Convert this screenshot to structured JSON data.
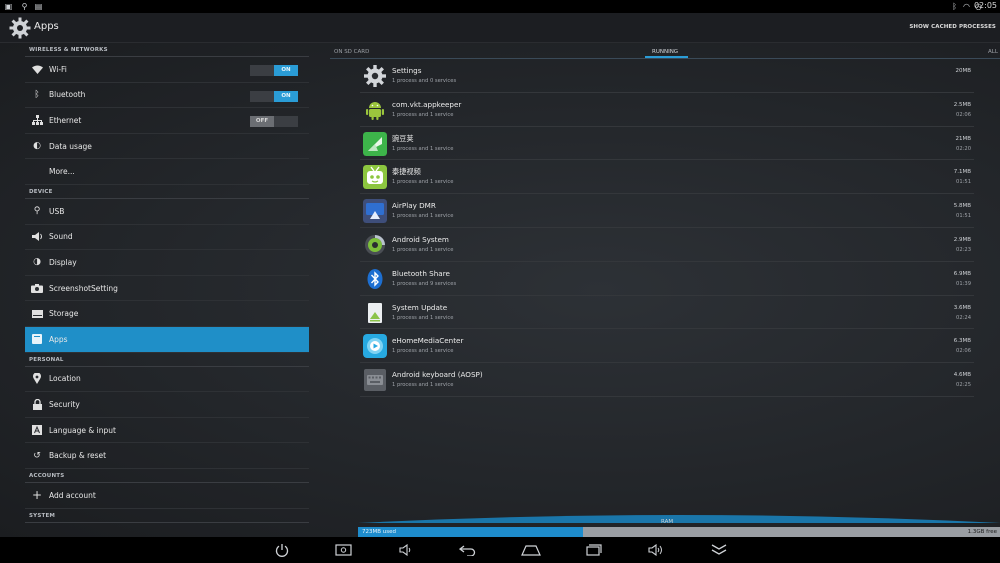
{
  "status_bar": {
    "time": "02:05",
    "left_icons": [
      "screenshot-icon",
      "usb-icon",
      "download-icon"
    ],
    "right_icons": [
      "bluetooth-icon",
      "wifi-icon",
      "clock-icon"
    ]
  },
  "action_bar": {
    "title": "Apps",
    "action": "SHOW CACHED PROCESSES"
  },
  "sidebar": {
    "sections": [
      {
        "header": "WIRELESS & NETWORKS",
        "items": [
          {
            "label": "Wi-Fi",
            "icon": "wifi-icon",
            "toggle": "ON"
          },
          {
            "label": "Bluetooth",
            "icon": "bluetooth-icon",
            "toggle": "ON"
          },
          {
            "label": "Ethernet",
            "icon": "ethernet-icon",
            "toggle": "OFF"
          },
          {
            "label": "Data usage",
            "icon": "data-usage-icon"
          },
          {
            "label": "More..."
          }
        ]
      },
      {
        "header": "DEVICE",
        "items": [
          {
            "label": "USB",
            "icon": "usb-icon"
          },
          {
            "label": "Sound",
            "icon": "sound-icon"
          },
          {
            "label": "Display",
            "icon": "display-icon"
          },
          {
            "label": "ScreenshotSetting",
            "icon": "camera-icon"
          },
          {
            "label": "Storage",
            "icon": "storage-icon"
          },
          {
            "label": "Apps",
            "icon": "apps-icon",
            "selected": true
          }
        ]
      },
      {
        "header": "PERSONAL",
        "items": [
          {
            "label": "Location",
            "icon": "location-icon"
          },
          {
            "label": "Security",
            "icon": "lock-icon"
          },
          {
            "label": "Language & input",
            "icon": "language-icon"
          },
          {
            "label": "Backup & reset",
            "icon": "backup-icon"
          }
        ]
      },
      {
        "header": "ACCOUNTS",
        "items": [
          {
            "label": "Add account",
            "icon": "plus-icon"
          }
        ]
      },
      {
        "header": "SYSTEM",
        "items": []
      }
    ]
  },
  "tabs": {
    "left": "ON SD CARD",
    "active": "RUNNING",
    "right": "ALL"
  },
  "running_apps": [
    {
      "name": "Settings",
      "detail": "1 process and 0 services",
      "size": "20MB",
      "time": "",
      "icon": "settings-gear-icon"
    },
    {
      "name": "com.vkt.appkeeper",
      "detail": "1 process and 1 service",
      "size": "2.5MB",
      "time": "02:06",
      "icon": "android-icon"
    },
    {
      "name": "豌豆荚",
      "detail": "1 process and 1 service",
      "size": "21MB",
      "time": "02:20",
      "icon": "wandoujia-icon"
    },
    {
      "name": "泰捷视频",
      "detail": "1 process and 1 service",
      "size": "7.1MB",
      "time": "01:51",
      "icon": "tv-robot-icon"
    },
    {
      "name": "AirPlay DMR",
      "detail": "1 process and 1 service",
      "size": "5.8MB",
      "time": "01:51",
      "icon": "airplay-icon"
    },
    {
      "name": "Android System",
      "detail": "1 process and 1 service",
      "size": "2.9MB",
      "time": "02:23",
      "icon": "android-system-icon"
    },
    {
      "name": "Bluetooth Share",
      "detail": "1 process and 9 services",
      "size": "6.9MB",
      "time": "01:39",
      "icon": "bluetooth-icon"
    },
    {
      "name": "System Update",
      "detail": "1 process and 1 service",
      "size": "3.6MB",
      "time": "02:24",
      "icon": "system-update-icon"
    },
    {
      "name": "eHomeMediaCenter",
      "detail": "1 process and 1 service",
      "size": "6.3MB",
      "time": "02:06",
      "icon": "media-center-icon"
    },
    {
      "name": "Android keyboard (AOSP)",
      "detail": "1 process and 1 service",
      "size": "4.6MB",
      "time": "02:25",
      "icon": "keyboard-icon"
    }
  ],
  "ram": {
    "label": "RAM",
    "used": "723MB used",
    "free": "1.3GB free",
    "used_fraction": 0.35
  },
  "nav_bar": [
    "power-icon",
    "screenshot-icon",
    "volume-down-icon",
    "back-icon",
    "home-icon",
    "recents-icon",
    "volume-up-icon",
    "hide-bar-icon"
  ],
  "colors": {
    "accent": "#1f8fc8",
    "background": "#23262a",
    "bar": "#000000"
  }
}
